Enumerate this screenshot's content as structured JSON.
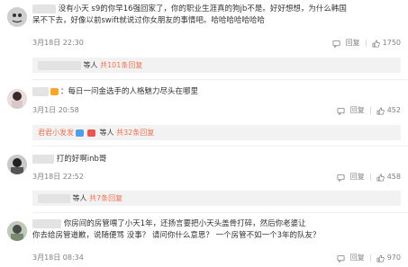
{
  "comments": [
    {
      "text_line1": "没有小天 s9的你早16强回家了，你的职业生涯真的狗jb不是。好好想想，为什么韩国",
      "text_line2": "呆不下去，好像以前swift就说过你女朋友的事情吧。哈哈哈哈哈哈哈",
      "date": "3月18日 22:30",
      "reply_label": "回复",
      "likes": "1750",
      "replies_suffix": "等人",
      "replies_link": "共101条回复"
    },
    {
      "text_line1": "：每日一问金选手的人格魅力尽头在哪里",
      "date": "3月1日 20:58",
      "reply_label": "回复",
      "likes": "452",
      "reply_name": "君君小发发",
      "replies_suffix": "等人",
      "replies_link": "共32条回复"
    },
    {
      "text_line1": "打的好啊inb哥",
      "date": "3月18日 22:52",
      "reply_label": "回复",
      "likes": "458",
      "replies_suffix": "等人",
      "replies_link": "共7条回复"
    },
    {
      "text_line1": "你房间的房管喂了小天1年，还扬言要把小天头盖骨打碎，然后你老婆让",
      "text_line2": "你去给房管道歉，说随便骂 没事？ 请问你什么意思？ 一个房管不如一个3年的队友？",
      "date": "3月18日 08:34",
      "reply_label": "回复",
      "likes": "970"
    }
  ],
  "colors": {
    "accent": "#eb7350",
    "meta": "#808080",
    "reply_bg": "#f2f2f2"
  },
  "icons": {
    "like": "thumbs-up-icon",
    "reply": "reply-icon"
  }
}
